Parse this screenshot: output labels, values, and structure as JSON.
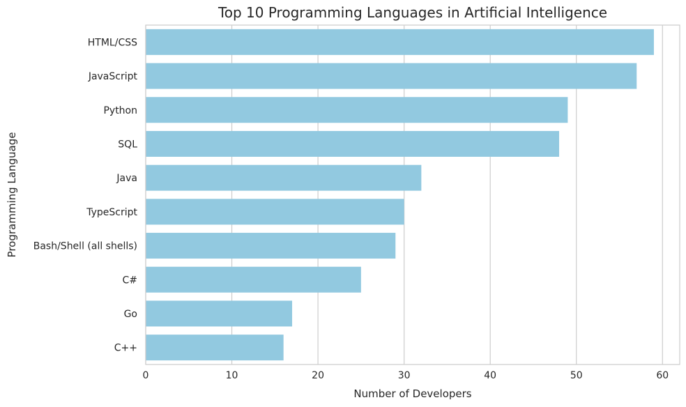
{
  "chart_data": {
    "type": "bar",
    "orientation": "horizontal",
    "title": "Top 10 Programming Languages in Artificial Intelligence",
    "xlabel": "Number of Developers",
    "ylabel": "Programming Language",
    "categories": [
      "HTML/CSS",
      "JavaScript",
      "Python",
      "SQL",
      "Java",
      "TypeScript",
      "Bash/Shell (all shells)",
      "C#",
      "Go",
      "C++"
    ],
    "values": [
      59,
      57,
      49,
      48,
      32,
      30,
      29,
      25,
      17,
      16
    ],
    "xlim": [
      0,
      62
    ],
    "xticks": [
      0,
      10,
      20,
      30,
      40,
      50,
      60
    ],
    "grid": "vertical",
    "bar_color": "#92c9e0"
  }
}
